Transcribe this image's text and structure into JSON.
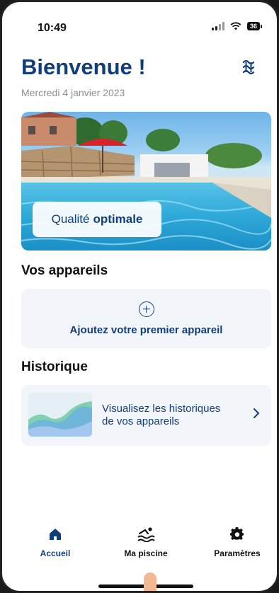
{
  "status_bar": {
    "time": "10:49",
    "battery": "36"
  },
  "header": {
    "title": "Bienvenue !",
    "date": "Mercredi 4 janvier 2023",
    "pool_icon": "pool-waves-icon"
  },
  "hero": {
    "quality_prefix": "Qualité",
    "quality_value": "optimale"
  },
  "devices": {
    "section_title": "Vos appareils",
    "add_label": "Ajoutez votre premier appareil",
    "add_icon": "plus-circle-icon"
  },
  "history": {
    "section_title": "Historique",
    "line1": "Visualisez les historiques",
    "line2": "de vos appareils",
    "chevron_icon": "chevron-right-icon"
  },
  "tabs": [
    {
      "label": "Accueil",
      "icon": "home-icon",
      "active": true
    },
    {
      "label": "Ma piscine",
      "icon": "swimmer-icon",
      "active": false
    },
    {
      "label": "Paramètres",
      "icon": "gear-icon",
      "active": false
    }
  ],
  "colors": {
    "brand": "#123e7c",
    "card_bg": "#f2f6fb",
    "muted": "#8a8f98"
  }
}
